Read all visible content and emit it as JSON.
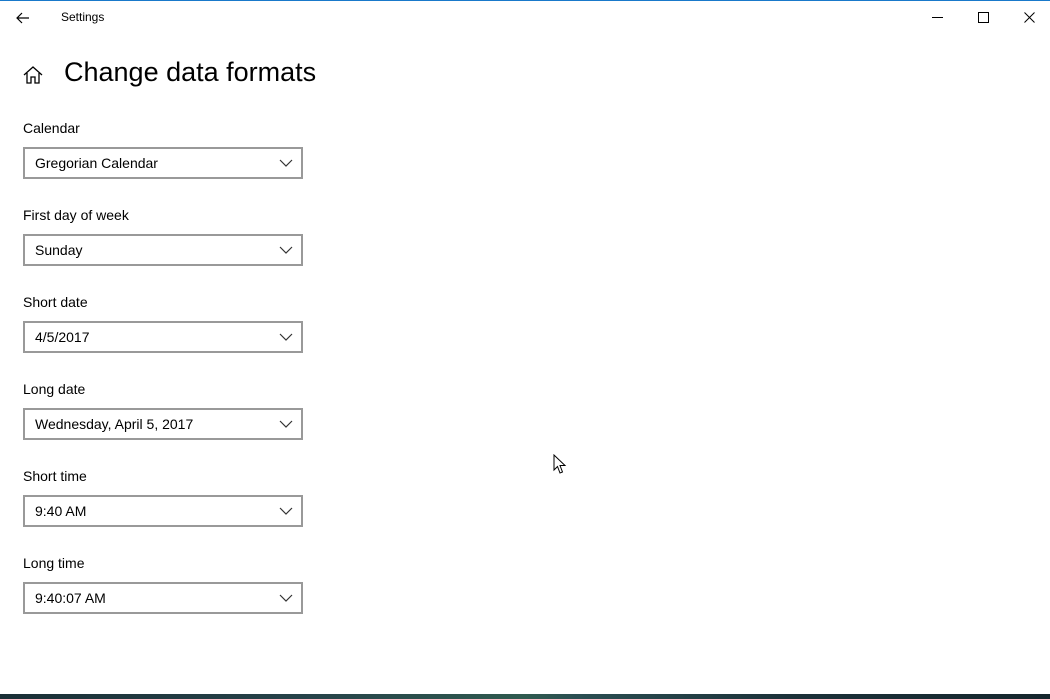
{
  "titlebar": {
    "app_title": "Settings",
    "back_icon": "back-arrow-icon",
    "minimize_icon": "minimize-icon",
    "maximize_icon": "maximize-icon",
    "close_icon": "close-icon",
    "accent_color": "#1979ca"
  },
  "page": {
    "home_icon": "home-icon",
    "title": "Change data formats"
  },
  "fields": [
    {
      "label": "Calendar",
      "value": "Gregorian Calendar"
    },
    {
      "label": "First day of week",
      "value": "Sunday"
    },
    {
      "label": "Short date",
      "value": "4/5/2017"
    },
    {
      "label": "Long date",
      "value": "Wednesday, April 5, 2017"
    },
    {
      "label": "Short time",
      "value": "9:40 AM"
    },
    {
      "label": "Long time",
      "value": "9:40:07 AM"
    }
  ],
  "colors": {
    "combo_border": "#999999",
    "background": "#ffffff",
    "text": "#000000"
  }
}
